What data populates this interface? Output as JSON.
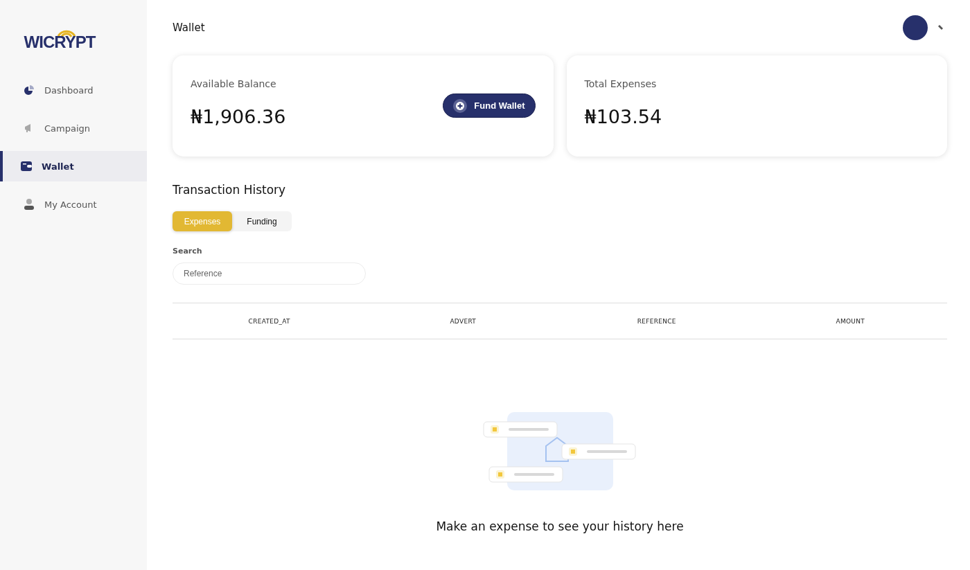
{
  "sidebar": {
    "logo": "WICRYPT",
    "items": [
      {
        "label": "Dashboard",
        "kind": "dashboard",
        "selected": false
      },
      {
        "label": "Campaign",
        "kind": "campaign",
        "selected": false
      },
      {
        "label": "Wallet",
        "kind": "wallet",
        "selected": true
      },
      {
        "label": "My Account",
        "kind": "account",
        "selected": false
      }
    ]
  },
  "header": {
    "title": "Wallet"
  },
  "cards": [
    {
      "label": "Available Balance",
      "amount": "₦1,906.36",
      "button": "Fund Wallet"
    },
    {
      "label": "Total Expenses",
      "amount": "₦103.54"
    }
  ],
  "history": {
    "title": "Transaction History",
    "tabs": [
      {
        "label": "Expenses",
        "selected": true
      },
      {
        "label": "Funding",
        "selected": false
      }
    ],
    "search": {
      "label": "Search",
      "placeholder": "Reference"
    },
    "table": {
      "columns": [
        "CREATED_AT",
        "ADVERT",
        "REFERENCE",
        "AMOUNT"
      ]
    },
    "empty_message": "Make an expense to see your history here"
  }
}
